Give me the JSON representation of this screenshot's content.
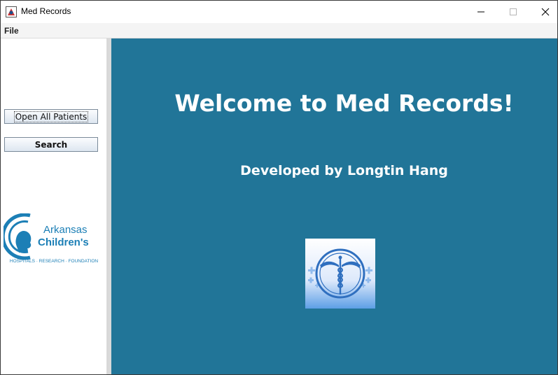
{
  "window": {
    "title": "Med Records",
    "icon": "app-icon"
  },
  "menu": {
    "file": "File"
  },
  "sidebar": {
    "open_all_label": "Open All Patients",
    "search_label": "Search",
    "logo": {
      "line1": "Arkansas",
      "line2": "Children's",
      "tagline": "HOSPITALS · RESEARCH · FOUNDATION"
    }
  },
  "main": {
    "welcome": "Welcome to Med Records!",
    "developer": "Developed by Longtin Hang",
    "emblem_icon": "caduceus-icon"
  },
  "colors": {
    "main_background": "#217598",
    "logo_blue": "#1c7fb6"
  }
}
